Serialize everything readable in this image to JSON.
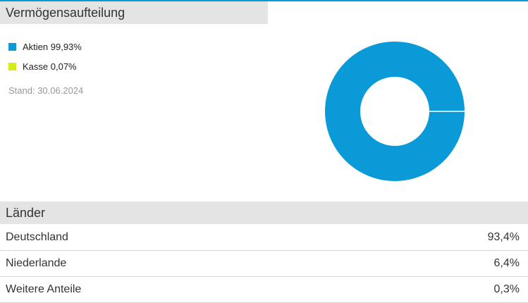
{
  "allocation": {
    "heading": "Vermögensaufteilung",
    "stand": "Stand: 30.06.2024"
  },
  "chart_data": {
    "type": "pie",
    "categories": [
      "Aktien",
      "Kasse"
    ],
    "values": [
      99.93,
      0.07
    ],
    "colors": [
      "#0a9ad8",
      "#d4ec1a"
    ],
    "legend_labels": [
      "Aktien 99,93%",
      "Kasse 0,07%"
    ],
    "legend_position": "left",
    "donut": true
  },
  "countries": {
    "heading": "Länder",
    "rows": [
      {
        "name": "Deutschland",
        "value": "93,4%"
      },
      {
        "name": "Niederlande",
        "value": "6,4%"
      },
      {
        "name": "Weitere Anteile",
        "value": "0,3%"
      }
    ]
  }
}
